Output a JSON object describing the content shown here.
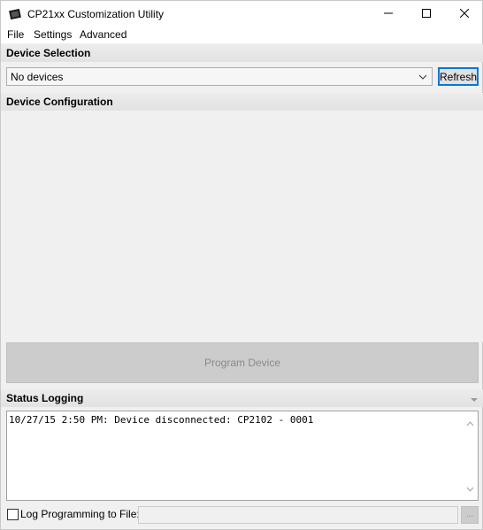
{
  "window": {
    "title": "CP21xx Customization Utility",
    "icon": "chip-app-icon",
    "controls": [
      "minimize-icon",
      "maximize-icon",
      "close-icon"
    ]
  },
  "menu": {
    "items": [
      "File",
      "Settings",
      "Advanced"
    ]
  },
  "device_selection": {
    "header": "Device Selection",
    "selected_value": "No devices",
    "refresh_label": "Refresh"
  },
  "device_configuration": {
    "header": "Device Configuration"
  },
  "program": {
    "label": "Program Device",
    "enabled": false
  },
  "status_logging": {
    "header": "Status Logging",
    "entries": [
      "10/27/15 2:50 PM: Device disconnected: CP2102 - 0001"
    ]
  },
  "log_to_file": {
    "checkbox_label": "Log Programming to File:",
    "checked": false,
    "path_value": "",
    "browse_label": "..."
  },
  "colors": {
    "accent_border": "#0078d7",
    "header_bg": "#e6e6e6",
    "disabled_button": "#cccccc"
  }
}
